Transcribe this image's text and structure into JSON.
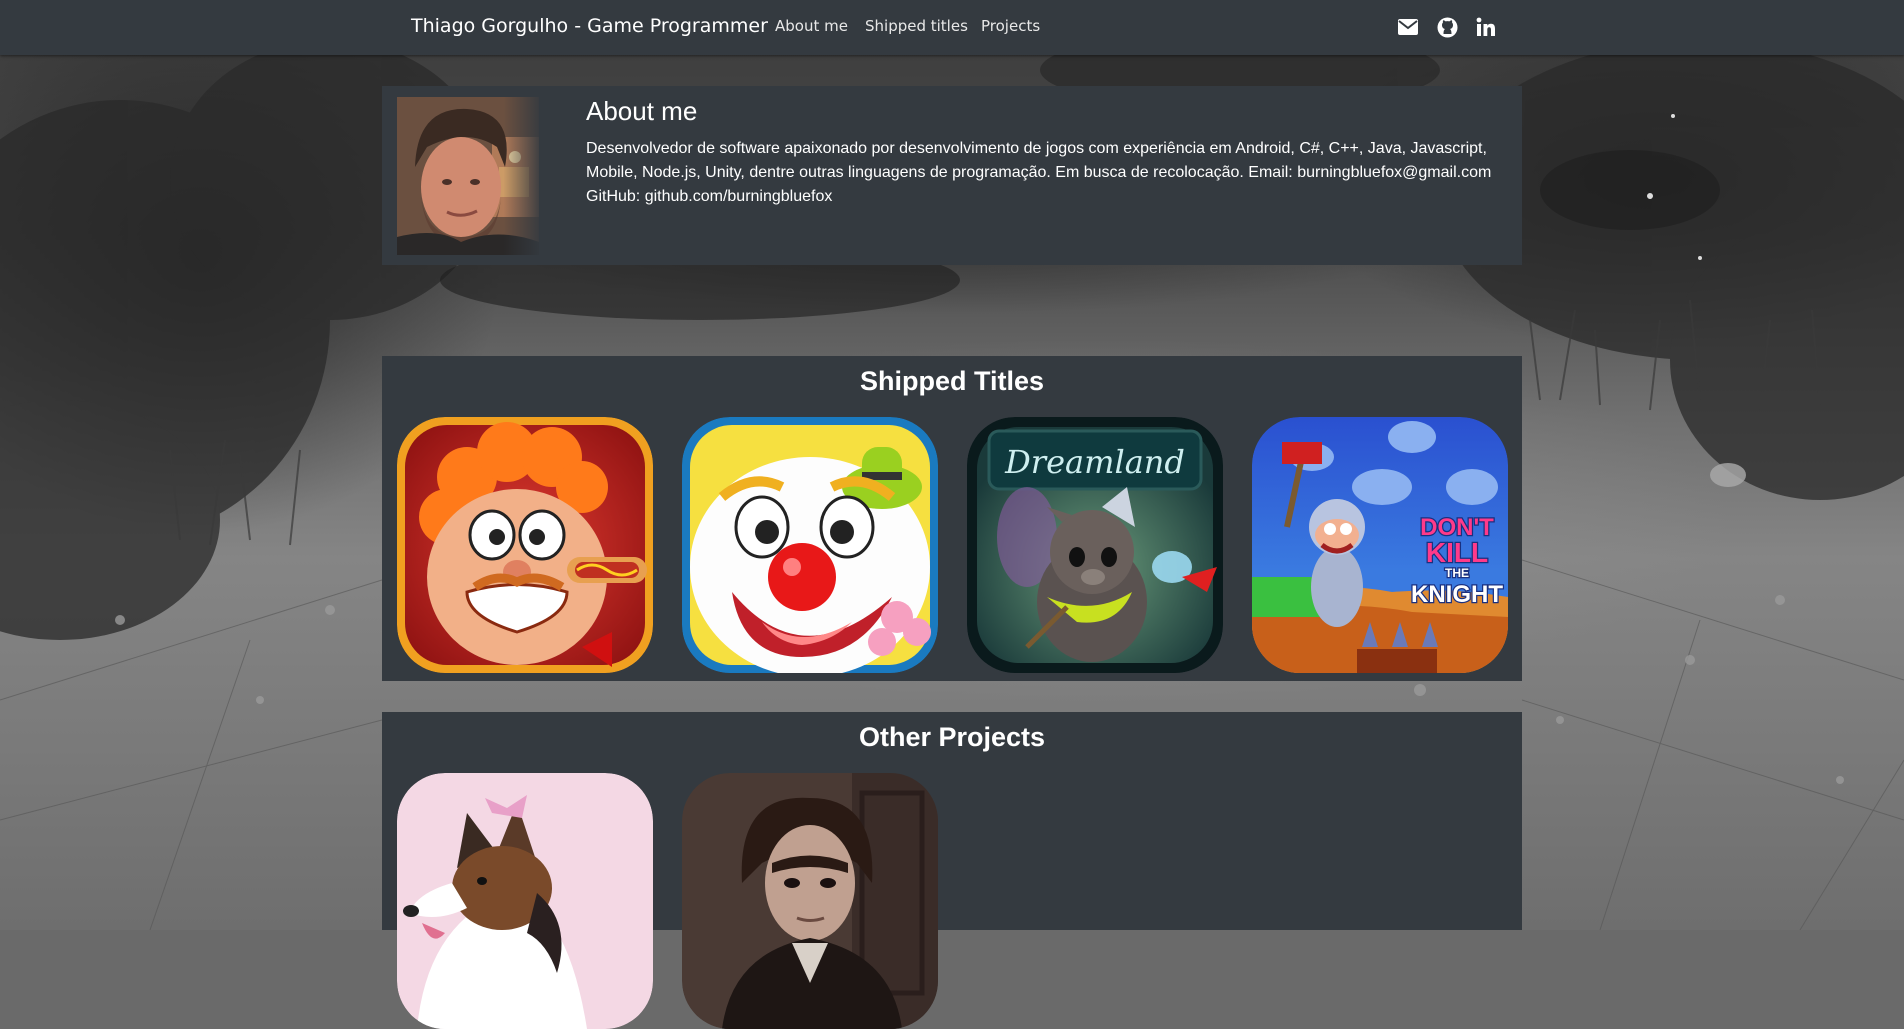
{
  "navbar": {
    "brand": "Thiago Gorgulho - Game Programmer",
    "links": [
      {
        "label": "About me"
      },
      {
        "label": "Shipped titles"
      },
      {
        "label": "Projects"
      }
    ],
    "icons": [
      "envelope-icon",
      "github-icon",
      "linkedin-icon"
    ]
  },
  "about": {
    "title": "About me",
    "description": "Desenvolvedor de software apaixonado por desenvolvimento de jogos com experiência em Android, C#, C++, Java, Javascript, Mobile, Node.js, Unity, dentre outras linguagens de programação. Em busca de recolocação. Email: burningbluefox@gmail.com",
    "github": "GitHub: github.com/burningbluefox"
  },
  "shipped": {
    "title": "Shipped Titles",
    "games": [
      {
        "icon": "hotdog-chef-game-icon"
      },
      {
        "icon": "clown-game-icon"
      },
      {
        "icon": "dreamland-game-icon",
        "logo_text": "Dreamland"
      },
      {
        "icon": "dont-kill-the-knight-game-icon",
        "logo_text": [
          "DON'T",
          "KILL",
          "THE",
          "KNIGHT"
        ]
      }
    ]
  },
  "projects": {
    "title": "Other Projects",
    "items": [
      {
        "icon": "collie-dog-project-icon"
      },
      {
        "icon": "dark-character-project-icon"
      }
    ]
  },
  "colors": {
    "navbar": "#343a40",
    "panel": "#343a40",
    "text": "#ffffff"
  }
}
